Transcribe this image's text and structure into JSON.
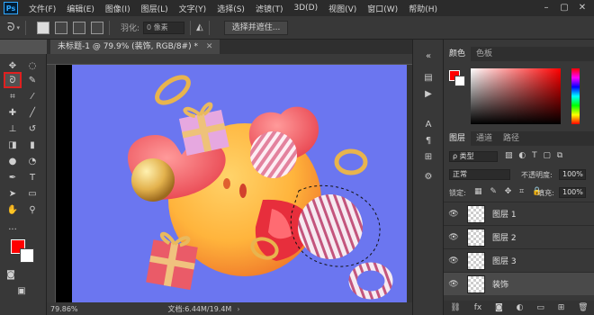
{
  "menubar": {
    "logo": "Ps",
    "items": [
      "文件(F)",
      "编辑(E)",
      "图像(I)",
      "图层(L)",
      "文字(Y)",
      "选择(S)",
      "滤镜(T)",
      "3D(D)",
      "视图(V)",
      "窗口(W)",
      "帮助(H)"
    ]
  },
  "options": {
    "feather_label": "羽化:",
    "feather_value": "0 像素",
    "select_mask_button": "选择并遮住..."
  },
  "document": {
    "tab_title": "未标题-1 @ 79.9% (装饰, RGB/8#) *",
    "zoom": "79.86%",
    "doc_info": "文档:6.44M/19.4M"
  },
  "color_panel": {
    "tabs": [
      "颜色",
      "色板"
    ],
    "foreground": "#ff0000",
    "background": "#ffffff"
  },
  "layers_panel": {
    "tabs": [
      "图层",
      "通道",
      "路径"
    ],
    "kind_filter": "ρ 类型",
    "blend_mode": "正常",
    "opacity_label": "不透明度:",
    "opacity_value": "100%",
    "lock_label": "锁定:",
    "fill_label": "填充:",
    "fill_value": "100%",
    "layers": [
      {
        "name": "图层 1",
        "selected": false
      },
      {
        "name": "图层 2",
        "selected": false
      },
      {
        "name": "图层 3",
        "selected": false
      },
      {
        "name": "装饰",
        "selected": true
      }
    ],
    "footer_icons": [
      "link-icon",
      "fx-icon",
      "mask-icon",
      "adjustment-icon",
      "folder-icon",
      "new-layer-icon",
      "trash-icon"
    ]
  },
  "colors": {
    "canvas_bg": "#6b76f0",
    "accent_red": "#ff0000"
  }
}
